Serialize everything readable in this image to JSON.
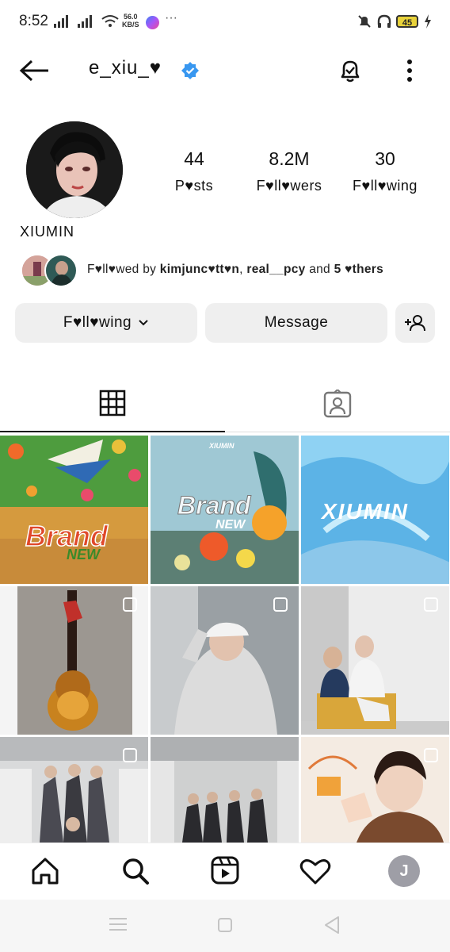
{
  "status_bar": {
    "time": "8:52",
    "net_speed": "56.0",
    "net_unit": "KB/S",
    "more": "···",
    "battery": "45"
  },
  "header": {
    "username": "e_xiu_♥"
  },
  "stats": [
    {
      "value": "44",
      "label": "P♥sts"
    },
    {
      "value": "8.2M",
      "label": "F♥ll♥wers"
    },
    {
      "value": "30",
      "label": "F♥ll♥wing"
    }
  ],
  "profile": {
    "display_name": "XIUMIN"
  },
  "followed_by": {
    "prefix": "F♥ll♥wed by ",
    "user1": "kimjunc♥tt♥n",
    "sep": ", ",
    "user2": "real__pcy",
    "and": " and ",
    "others": "5 ♥thers"
  },
  "buttons": {
    "following": "F♥ll♥wing",
    "message": "Message"
  },
  "grid": {
    "post1_title": "Brand",
    "post1_sub": "NEW",
    "post2_top": "XIUMIN",
    "post2_title": "Brand",
    "post2_sub": "NEW",
    "post3_title": "XIUMIN"
  },
  "bottom_nav": {
    "profile_initial": "J"
  },
  "icons": [
    "back-arrow-icon",
    "verified-badge-icon",
    "notification-bell-icon",
    "more-vertical-icon",
    "chevron-down-icon",
    "add-person-icon",
    "grid-icon",
    "tagged-icon",
    "home-icon",
    "search-icon",
    "reels-icon",
    "heart-icon",
    "profile-icon"
  ]
}
